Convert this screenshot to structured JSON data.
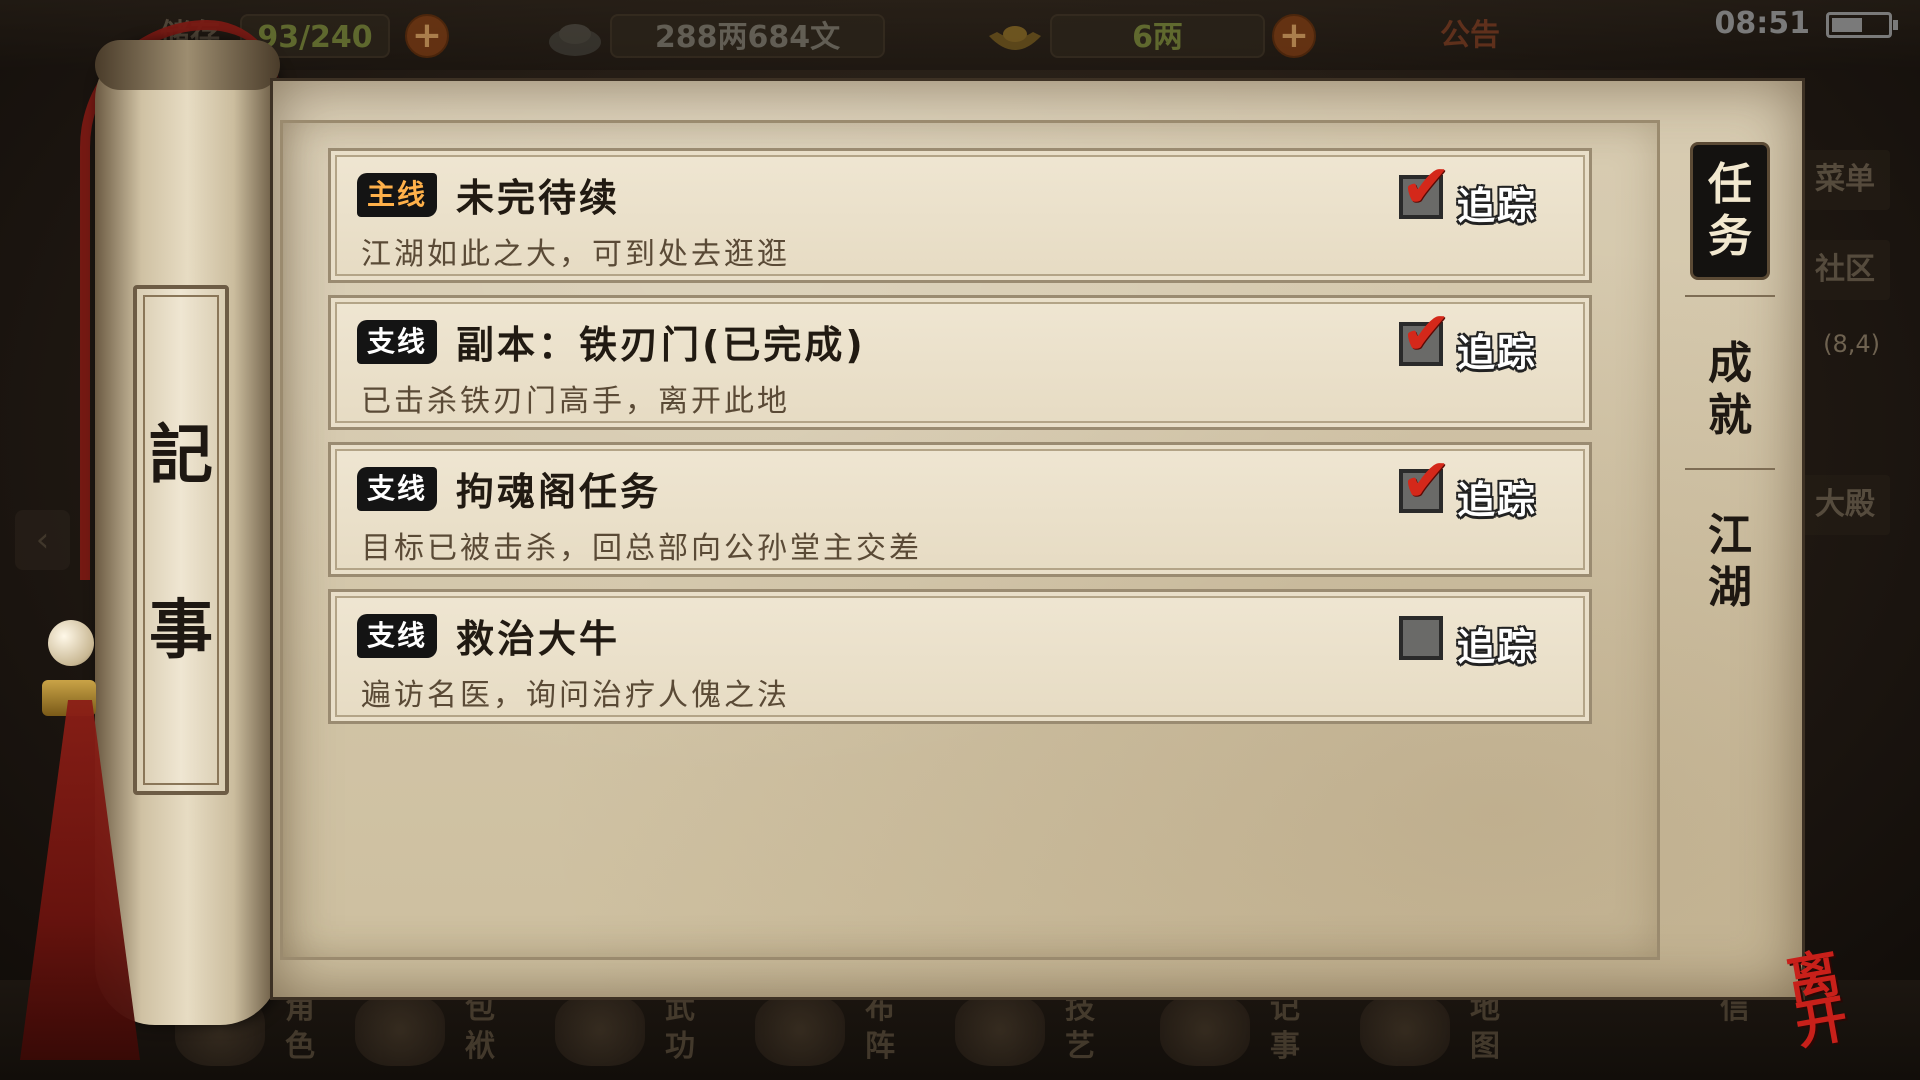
{
  "topbar": {
    "bag_label": "储存",
    "bag_count": "93/240",
    "money": "288两684文",
    "gold": "6两",
    "notice": "公告",
    "time": "08:51"
  },
  "side_menu": {
    "menu": "菜单",
    "community": "社区",
    "coord": "(8,4)",
    "location": "大殿"
  },
  "bottom_nav": [
    {
      "label": "角色"
    },
    {
      "label": "包袱"
    },
    {
      "label": "武功"
    },
    {
      "label": "布阵"
    },
    {
      "label": "技艺"
    },
    {
      "label": "记事"
    },
    {
      "label": "地图"
    },
    {
      "label": "信"
    }
  ],
  "scroll": {
    "title_top": "記",
    "title_bottom": "事"
  },
  "quests": [
    {
      "type_label": "主线",
      "title": "未完待续",
      "desc": "江湖如此之大，可到处去逛逛",
      "track_label": "追踪",
      "tracked": true
    },
    {
      "type_label": "支线",
      "title": "副本：铁刃门(已完成)",
      "desc": "已击杀铁刃门高手，离开此地",
      "track_label": "追踪",
      "tracked": true
    },
    {
      "type_label": "支线",
      "title": "拘魂阁任务",
      "desc": "目标已被击杀，回总部向公孙堂主交差",
      "track_label": "追踪",
      "tracked": true
    },
    {
      "type_label": "支线",
      "title": "救治大牛",
      "desc": "遍访名医，询问治疗人傀之法",
      "track_label": "追踪",
      "tracked": false
    }
  ],
  "tabs": {
    "quest_1": "任",
    "quest_2": "务",
    "achieve_1": "成",
    "achieve_2": "就",
    "jianghu_1": "江",
    "jianghu_2": "湖"
  },
  "leave_label": "离开",
  "colors": {
    "parchment": "#d8ccb2",
    "check": "#d4281a",
    "main_badge_text": "#ffb14a",
    "leave": "#c8201a"
  }
}
